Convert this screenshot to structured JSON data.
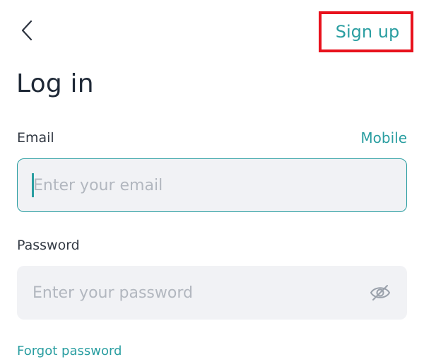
{
  "header": {
    "back_icon": "chevron-left-icon",
    "signup_label": "Sign up",
    "highlight_color": "#e8121d"
  },
  "title": "Log in",
  "email": {
    "label": "Email",
    "mode_toggle_label": "Mobile",
    "placeholder": "Enter your email",
    "value": ""
  },
  "password": {
    "label": "Password",
    "placeholder": "Enter your password",
    "value": "",
    "visibility_icon": "eye-off-icon"
  },
  "forgot_password_label": "Forgot password",
  "colors": {
    "accent": "#2a9ea1",
    "input_background": "#f1f2f5",
    "text": "#1f2937",
    "placeholder": "#b2b7bf"
  }
}
